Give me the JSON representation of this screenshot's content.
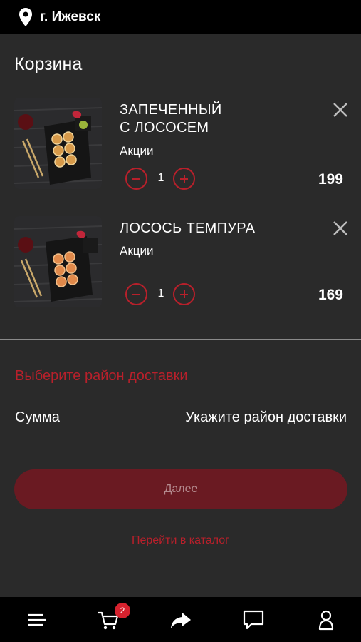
{
  "header": {
    "city": "г. Ижевск"
  },
  "page": {
    "title": "Корзина"
  },
  "cart": {
    "items": [
      {
        "name_line1": "ЗАПЕЧЕННЫЙ",
        "name_line2": "С ЛОСОСЕМ",
        "category": "Акции",
        "quantity": "1",
        "price": "199"
      },
      {
        "name_line1": "ЛОСОСЬ ТЕМПУРА",
        "category": "Акции",
        "quantity": "1",
        "price": "169"
      }
    ]
  },
  "delivery": {
    "choose_district": "Выберите район доставки",
    "sum_label": "Сумма",
    "sum_value": "Укажите район доставки"
  },
  "actions": {
    "next_label": "Далее",
    "catalog_label": "Перейти в каталог"
  },
  "bottom_nav": {
    "cart_badge": "2",
    "icons": [
      "menu-icon",
      "cart-icon",
      "share-icon",
      "chat-icon",
      "profile-icon"
    ]
  },
  "colors": {
    "accent": "#b8202b",
    "badge": "#d6222e",
    "button_bg": "#6a1a22",
    "background": "#2a2a2a",
    "bar_bg": "#000000"
  }
}
